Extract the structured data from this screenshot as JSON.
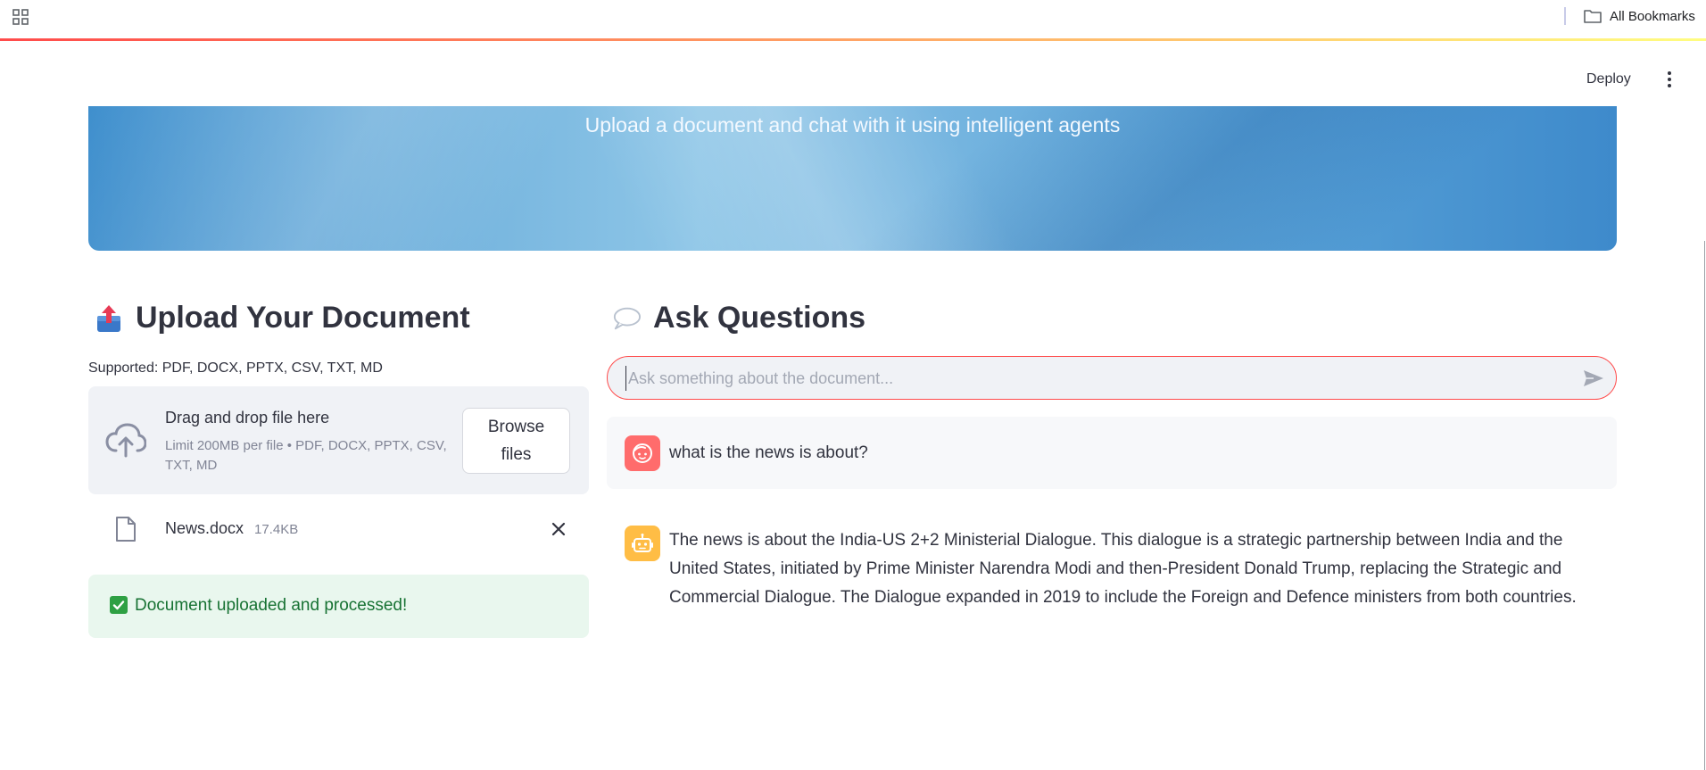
{
  "browser": {
    "bookmarks_label": "All Bookmarks",
    "apps_icon": "apps-grid-icon",
    "folder_icon": "folder-icon"
  },
  "header": {
    "deploy_label": "Deploy",
    "menu_icon": "more-vertical-icon"
  },
  "banner": {
    "subtitle": "Upload a document and chat with it using intelligent agents"
  },
  "upload": {
    "title": "Upload Your Document",
    "title_icon": "outbox-tray-icon",
    "supported": "Supported: PDF, DOCX, PPTX, CSV, TXT, MD",
    "dropzone_title": "Drag and drop file here",
    "dropzone_limit": "Limit 200MB per file • PDF, DOCX, PPTX, CSV, TXT, MD",
    "browse_label": "Browse files",
    "file_name": "News.docx",
    "file_size": "17.4KB",
    "success_message": "Document uploaded and processed!"
  },
  "chat": {
    "title": "Ask Questions",
    "title_icon": "speech-balloon-icon",
    "input_placeholder": "Ask something about the document...",
    "messages": [
      {
        "role": "user",
        "text": "what is the news is about?"
      },
      {
        "role": "assistant",
        "text": "The news is about the India-US 2+2 Ministerial Dialogue. This dialogue is a strategic partnership between India and the United States, initiated by Prime Minister Narendra Modi and then-President Donald Trump, replacing the Strategic and Commercial Dialogue. The Dialogue expanded in 2019 to include the Foreign and Defence ministers from both countries."
      }
    ]
  },
  "colors": {
    "accent": "#ff4b4b",
    "success_bg": "#e9f7ee",
    "success_text": "#177233",
    "user_avatar": "#ff6c6c",
    "bot_avatar": "#ffbd45"
  }
}
